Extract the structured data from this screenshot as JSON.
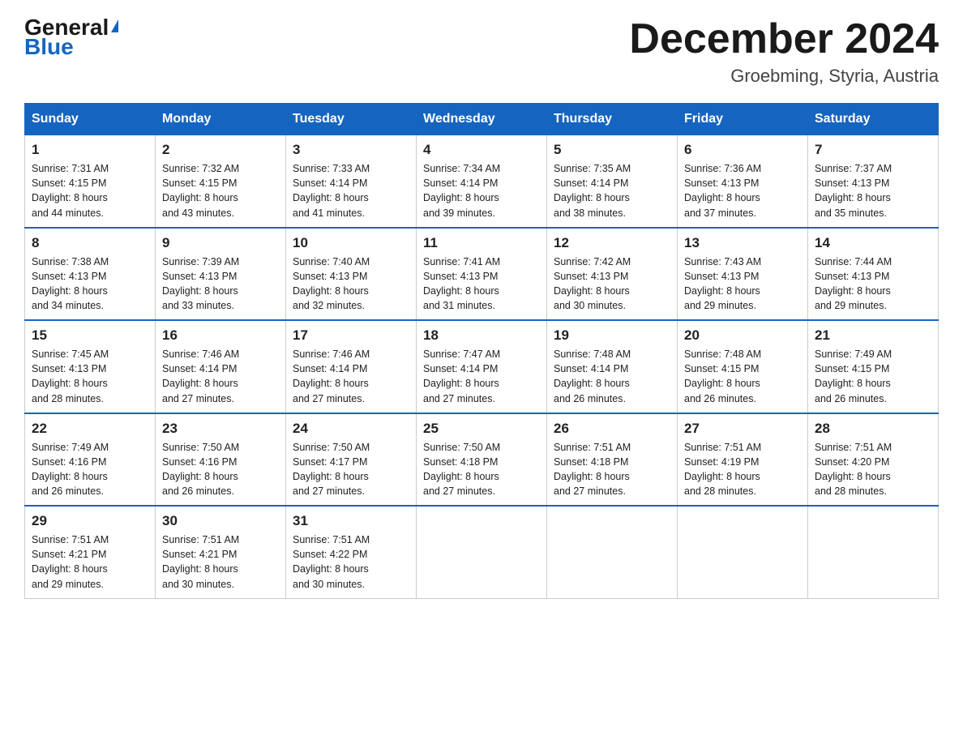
{
  "logo": {
    "general": "General",
    "blue": "Blue"
  },
  "title": "December 2024",
  "location": "Groebming, Styria, Austria",
  "headers": [
    "Sunday",
    "Monday",
    "Tuesday",
    "Wednesday",
    "Thursday",
    "Friday",
    "Saturday"
  ],
  "weeks": [
    [
      {
        "day": "1",
        "sunrise": "7:31 AM",
        "sunset": "4:15 PM",
        "daylight": "8 hours and 44 minutes."
      },
      {
        "day": "2",
        "sunrise": "7:32 AM",
        "sunset": "4:15 PM",
        "daylight": "8 hours and 43 minutes."
      },
      {
        "day": "3",
        "sunrise": "7:33 AM",
        "sunset": "4:14 PM",
        "daylight": "8 hours and 41 minutes."
      },
      {
        "day": "4",
        "sunrise": "7:34 AM",
        "sunset": "4:14 PM",
        "daylight": "8 hours and 39 minutes."
      },
      {
        "day": "5",
        "sunrise": "7:35 AM",
        "sunset": "4:14 PM",
        "daylight": "8 hours and 38 minutes."
      },
      {
        "day": "6",
        "sunrise": "7:36 AM",
        "sunset": "4:13 PM",
        "daylight": "8 hours and 37 minutes."
      },
      {
        "day": "7",
        "sunrise": "7:37 AM",
        "sunset": "4:13 PM",
        "daylight": "8 hours and 35 minutes."
      }
    ],
    [
      {
        "day": "8",
        "sunrise": "7:38 AM",
        "sunset": "4:13 PM",
        "daylight": "8 hours and 34 minutes."
      },
      {
        "day": "9",
        "sunrise": "7:39 AM",
        "sunset": "4:13 PM",
        "daylight": "8 hours and 33 minutes."
      },
      {
        "day": "10",
        "sunrise": "7:40 AM",
        "sunset": "4:13 PM",
        "daylight": "8 hours and 32 minutes."
      },
      {
        "day": "11",
        "sunrise": "7:41 AM",
        "sunset": "4:13 PM",
        "daylight": "8 hours and 31 minutes."
      },
      {
        "day": "12",
        "sunrise": "7:42 AM",
        "sunset": "4:13 PM",
        "daylight": "8 hours and 30 minutes."
      },
      {
        "day": "13",
        "sunrise": "7:43 AM",
        "sunset": "4:13 PM",
        "daylight": "8 hours and 29 minutes."
      },
      {
        "day": "14",
        "sunrise": "7:44 AM",
        "sunset": "4:13 PM",
        "daylight": "8 hours and 29 minutes."
      }
    ],
    [
      {
        "day": "15",
        "sunrise": "7:45 AM",
        "sunset": "4:13 PM",
        "daylight": "8 hours and 28 minutes."
      },
      {
        "day": "16",
        "sunrise": "7:46 AM",
        "sunset": "4:14 PM",
        "daylight": "8 hours and 27 minutes."
      },
      {
        "day": "17",
        "sunrise": "7:46 AM",
        "sunset": "4:14 PM",
        "daylight": "8 hours and 27 minutes."
      },
      {
        "day": "18",
        "sunrise": "7:47 AM",
        "sunset": "4:14 PM",
        "daylight": "8 hours and 27 minutes."
      },
      {
        "day": "19",
        "sunrise": "7:48 AM",
        "sunset": "4:14 PM",
        "daylight": "8 hours and 26 minutes."
      },
      {
        "day": "20",
        "sunrise": "7:48 AM",
        "sunset": "4:15 PM",
        "daylight": "8 hours and 26 minutes."
      },
      {
        "day": "21",
        "sunrise": "7:49 AM",
        "sunset": "4:15 PM",
        "daylight": "8 hours and 26 minutes."
      }
    ],
    [
      {
        "day": "22",
        "sunrise": "7:49 AM",
        "sunset": "4:16 PM",
        "daylight": "8 hours and 26 minutes."
      },
      {
        "day": "23",
        "sunrise": "7:50 AM",
        "sunset": "4:16 PM",
        "daylight": "8 hours and 26 minutes."
      },
      {
        "day": "24",
        "sunrise": "7:50 AM",
        "sunset": "4:17 PM",
        "daylight": "8 hours and 27 minutes."
      },
      {
        "day": "25",
        "sunrise": "7:50 AM",
        "sunset": "4:18 PM",
        "daylight": "8 hours and 27 minutes."
      },
      {
        "day": "26",
        "sunrise": "7:51 AM",
        "sunset": "4:18 PM",
        "daylight": "8 hours and 27 minutes."
      },
      {
        "day": "27",
        "sunrise": "7:51 AM",
        "sunset": "4:19 PM",
        "daylight": "8 hours and 28 minutes."
      },
      {
        "day": "28",
        "sunrise": "7:51 AM",
        "sunset": "4:20 PM",
        "daylight": "8 hours and 28 minutes."
      }
    ],
    [
      {
        "day": "29",
        "sunrise": "7:51 AM",
        "sunset": "4:21 PM",
        "daylight": "8 hours and 29 minutes."
      },
      {
        "day": "30",
        "sunrise": "7:51 AM",
        "sunset": "4:21 PM",
        "daylight": "8 hours and 30 minutes."
      },
      {
        "day": "31",
        "sunrise": "7:51 AM",
        "sunset": "4:22 PM",
        "daylight": "8 hours and 30 minutes."
      },
      null,
      null,
      null,
      null
    ]
  ],
  "labels": {
    "sunrise": "Sunrise:",
    "sunset": "Sunset:",
    "daylight": "Daylight:"
  }
}
